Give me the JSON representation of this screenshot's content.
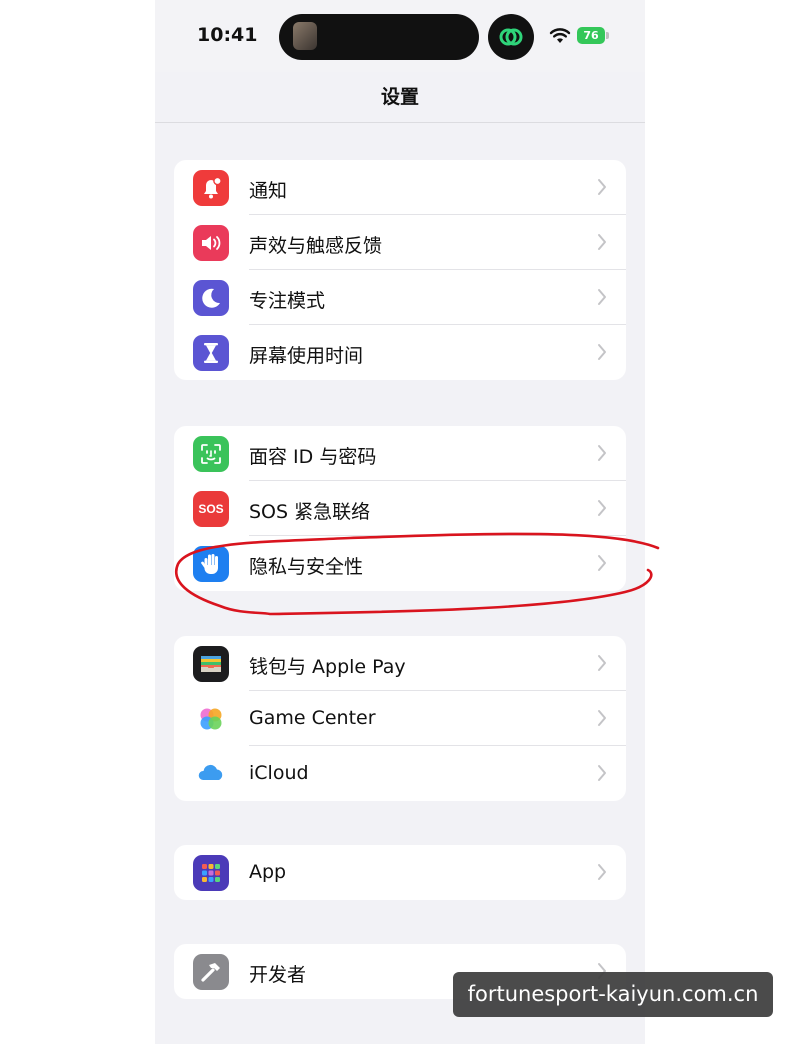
{
  "status_bar": {
    "time": "10:41",
    "battery": "76"
  },
  "header": {
    "title": "设置"
  },
  "groups": [
    {
      "items": [
        {
          "label": "通知",
          "icon": "bell-badge-icon",
          "color": "#ef3b3b"
        },
        {
          "label": "声效与触感反馈",
          "icon": "speaker-icon",
          "color": "#ea3a5a"
        },
        {
          "label": "专注模式",
          "icon": "moon-icon",
          "color": "#5b55d3"
        },
        {
          "label": "屏幕使用时间",
          "icon": "hourglass-icon",
          "color": "#5b55d3"
        }
      ]
    },
    {
      "items": [
        {
          "label": "面容 ID 与密码",
          "icon": "face-id-icon",
          "color": "#3ac35a"
        },
        {
          "label": "SOS 紧急联络",
          "icon": "sos-icon",
          "color": "#ea3a3a",
          "icon_text": "SOS"
        },
        {
          "label": "隐私与安全性",
          "icon": "hand-icon",
          "color": "#1e7ff0"
        }
      ]
    },
    {
      "items": [
        {
          "label": "钱包与 Apple Pay",
          "icon": "wallet-icon",
          "color": "#1c1c1e"
        },
        {
          "label": "Game Center",
          "icon": "game-center-icon",
          "color": "#ffffff"
        },
        {
          "label": "iCloud",
          "icon": "cloud-icon",
          "color": "#ffffff"
        }
      ]
    },
    {
      "items": [
        {
          "label": "App",
          "icon": "app-grid-icon",
          "color": "#4b3ab8"
        }
      ]
    },
    {
      "items": [
        {
          "label": "开发者",
          "icon": "hammer-icon",
          "color": "#8a8a8e"
        }
      ]
    }
  ],
  "watermark": {
    "text": "fortunesport-kaiyun.com.cn"
  },
  "colors": {
    "background": "#f2f2f6",
    "annotation": "#d9141e"
  }
}
